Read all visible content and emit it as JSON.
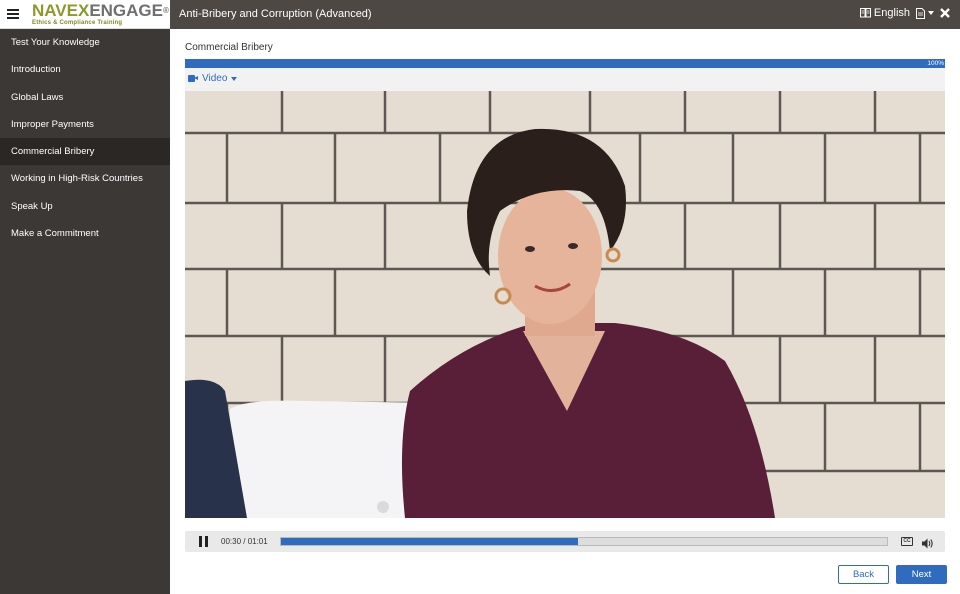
{
  "header": {
    "menu_icon": "hamburger-menu-icon",
    "logo": {
      "part1": "NAVEX",
      "part2": "ENGAGE",
      "reg": "®",
      "tagline": "Ethics & Compliance Training"
    },
    "course_title": "Anti-Bribery and Corruption (Advanced)",
    "language": "English",
    "language_icon": "language-book-icon",
    "document_icon": "document-icon",
    "close_icon": "close-x-icon"
  },
  "sidebar": {
    "items": [
      {
        "label": "Test Your Knowledge",
        "active": false
      },
      {
        "label": "Introduction",
        "active": false
      },
      {
        "label": "Global Laws",
        "active": false
      },
      {
        "label": "Improper Payments",
        "active": false
      },
      {
        "label": "Commercial Bribery",
        "active": true
      },
      {
        "label": "Working in High-Risk Countries",
        "active": false
      },
      {
        "label": "Speak Up",
        "active": false
      },
      {
        "label": "Make a Commitment",
        "active": false
      }
    ]
  },
  "main": {
    "section_title": "Commercial Bribery",
    "progress": {
      "value": 100,
      "label": "100%"
    },
    "media_tab": {
      "label": "Video",
      "icon": "video-camera-icon"
    }
  },
  "player": {
    "time_display": "00:30 / 01:01",
    "played_fraction": 0.49,
    "pause_icon": "pause-icon",
    "cc_icon": "closed-captions-icon",
    "cc_label": "CC",
    "volume_icon": "volume-icon"
  },
  "nav_buttons": {
    "back": "Back",
    "next": "Next"
  },
  "colors": {
    "accent": "#2f6cc0",
    "topbar": "#4d4844",
    "sidebar": "#3c3836",
    "sidebar_active": "#2a2725"
  }
}
